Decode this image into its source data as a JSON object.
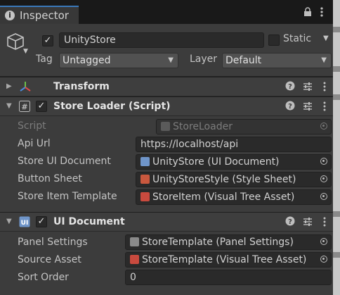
{
  "tab": {
    "title": "Inspector"
  },
  "gameobject": {
    "enabled": true,
    "name": "UnityStore",
    "static_label": "Static",
    "static_checked": false,
    "tag_label": "Tag",
    "tag_value": "Untagged",
    "layer_label": "Layer",
    "layer_value": "Default"
  },
  "components": [
    {
      "title": "Transform",
      "collapsed": true,
      "has_checkbox": false
    },
    {
      "title": "Store Loader (Script)",
      "enabled": true,
      "properties": [
        {
          "label": "Script",
          "value": "StoreLoader",
          "disabled": true
        },
        {
          "label": "Api Url",
          "value": "https://localhost/api"
        },
        {
          "label": "Store UI Document",
          "value": "UnityStore (UI Document)"
        },
        {
          "label": "Button Sheet",
          "value": "UnityStoreStyle (Style Sheet)"
        },
        {
          "label": "Store Item Template",
          "value": "StoreItem (Visual Tree Asset)"
        }
      ]
    },
    {
      "title": "UI Document",
      "enabled": true,
      "properties": [
        {
          "label": "Panel Settings",
          "value": "StoreTemplate (Panel Settings)"
        },
        {
          "label": "Source Asset",
          "value": "StoreTemplate (Visual Tree Asset)"
        },
        {
          "label": "Sort Order",
          "value": "0"
        }
      ]
    }
  ],
  "icons": {
    "tab": "info-icon",
    "lock": "lock-icon",
    "menu": "kebab-menu-icon",
    "gameobject": "cube-icon",
    "transform": "transform-axes-icon",
    "script": "csharp-script-icon",
    "uidocument": "ui-document-icon",
    "help": "help-icon",
    "presets": "presets-sliders-icon"
  },
  "colors": {
    "accent": "#3a79bb",
    "background": "#282828",
    "panel": "#3c3c3c"
  }
}
